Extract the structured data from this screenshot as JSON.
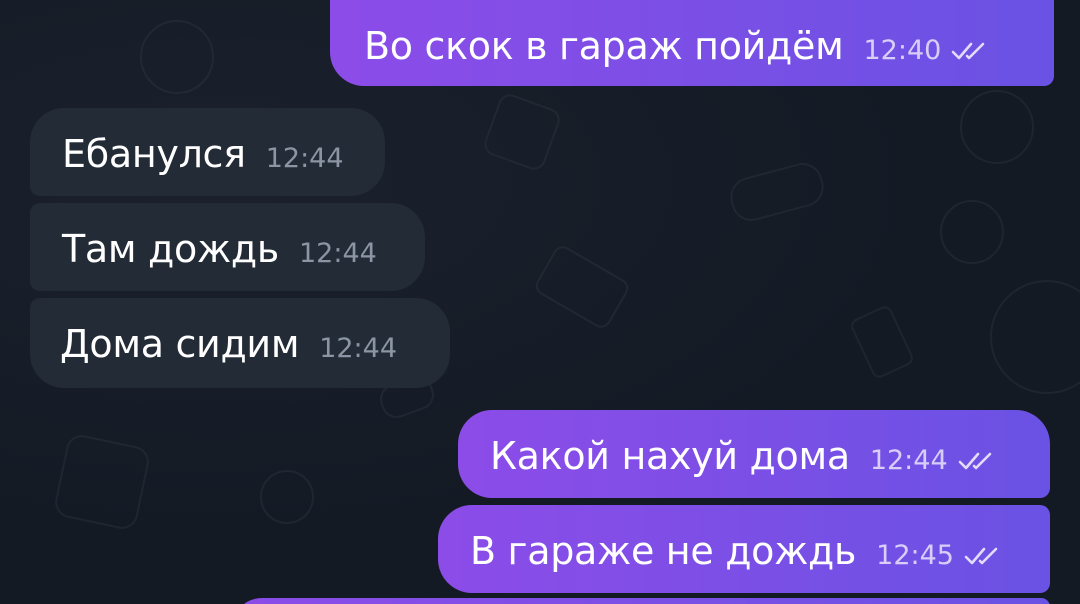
{
  "colors": {
    "background": "#141a24",
    "incoming_bubble": "#232b36",
    "outgoing_bubble_start": "#8c4ce8",
    "outgoing_bubble_end": "#6a52e4",
    "incoming_time": "#8b95a3"
  },
  "messages": [
    {
      "text": "Во скок в гараж пойдём",
      "time": "12:40",
      "direction": "outgoing",
      "status": "read",
      "status_icon": "double-check-icon"
    },
    {
      "text": "Ебанулся",
      "time": "12:44",
      "direction": "incoming"
    },
    {
      "text": "Там дождь",
      "time": "12:44",
      "direction": "incoming"
    },
    {
      "text": "Дома сидим",
      "time": "12:44",
      "direction": "incoming"
    },
    {
      "text": "Какой нахуй дома",
      "time": "12:44",
      "direction": "outgoing",
      "status": "read",
      "status_icon": "double-check-icon"
    },
    {
      "text": "В гараже не дождь",
      "time": "12:45",
      "direction": "outgoing",
      "status": "read",
      "status_icon": "double-check-icon"
    }
  ]
}
